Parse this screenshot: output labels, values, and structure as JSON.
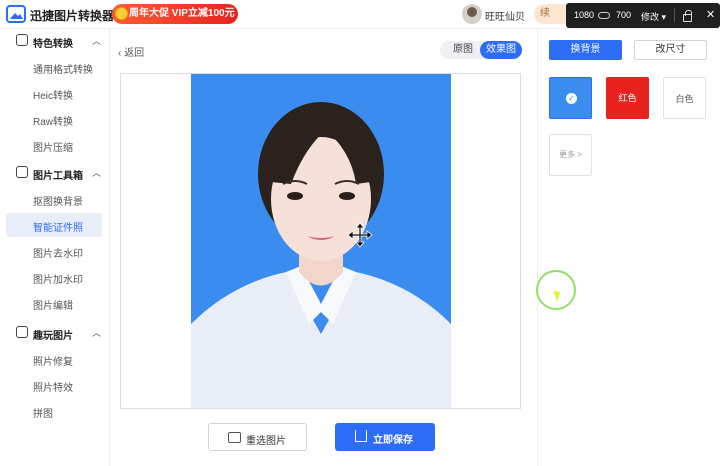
{
  "header": {
    "app_title": "迅捷图片转换器",
    "promo_text": "周年大促 VIP立减100元",
    "username": "旺旺仙贝",
    "vip_label": "续"
  },
  "recorder": {
    "width": "1080",
    "height": "700",
    "edit_label": "修改 ▾",
    "close": "✕"
  },
  "sidebar": {
    "groups": [
      {
        "label": "特色转换",
        "items": [
          "通用格式转换",
          "Heic转换",
          "Raw转换",
          "图片压缩"
        ]
      },
      {
        "label": "图片工具箱",
        "items": [
          "抠图换背景",
          "智能证件照",
          "图片去水印",
          "图片加水印",
          "图片编辑"
        ]
      },
      {
        "label": "趣玩图片",
        "items": [
          "照片修复",
          "照片特效",
          "拼图"
        ]
      }
    ],
    "active_item": "智能证件照"
  },
  "main": {
    "back_label": "返回",
    "view_original": "原图",
    "view_effect": "效果图",
    "reselect_label": "重选图片",
    "save_label": "立即保存"
  },
  "right_panel": {
    "tab_background": "换背景",
    "tab_size": "改尺寸",
    "swatches": [
      {
        "name": "蓝色",
        "label": "",
        "color": "#3b8cef",
        "selected": true
      },
      {
        "name": "红色",
        "label": "红色",
        "color": "#e8231f",
        "selected": false
      },
      {
        "name": "白色",
        "label": "白色",
        "color": "#ffffff",
        "selected": false
      }
    ],
    "more_label": "更多 >"
  },
  "colors": {
    "accent": "#2d6df6",
    "photo_bg": "#3b8cef",
    "promo": "#e8231f"
  }
}
